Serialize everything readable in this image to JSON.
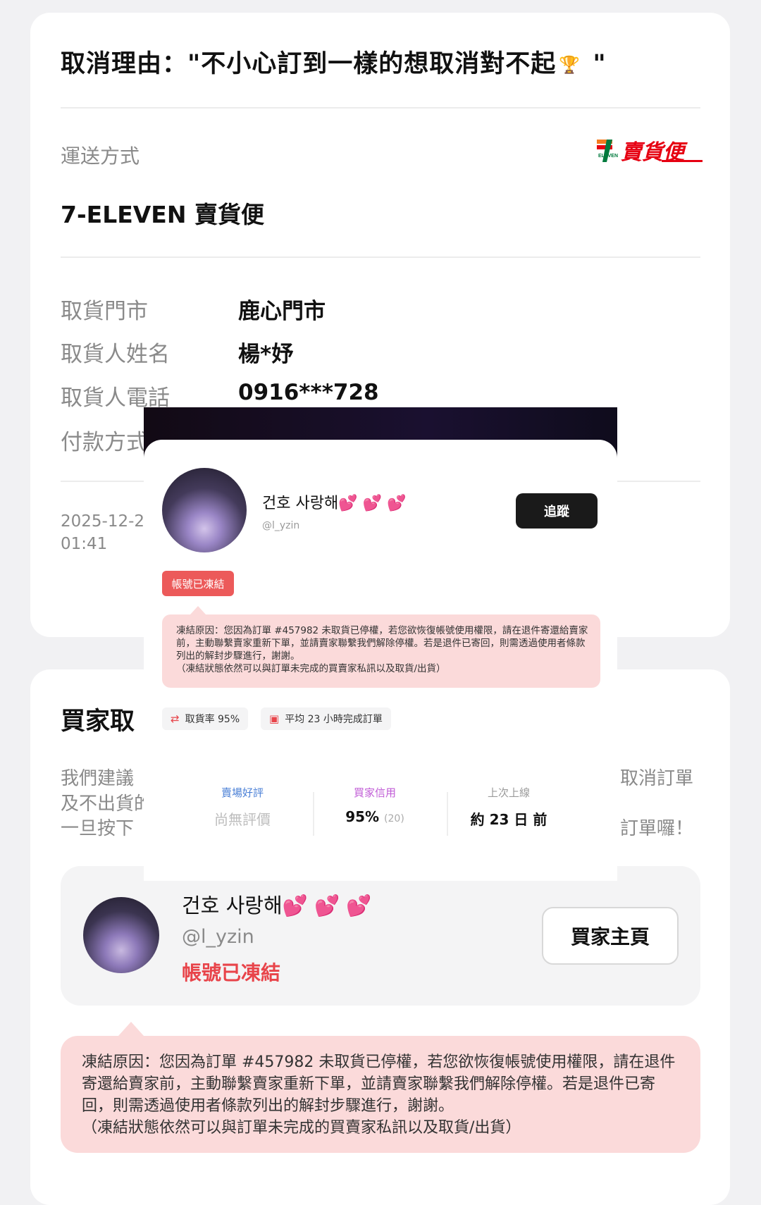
{
  "order": {
    "cancel_reason": "取消理由：\"不小心訂到一樣的想取消對不起",
    "cancel_reason_suffix": " \"",
    "shipping_label": "運送方式",
    "shipping_logo_small": "ELEVEN",
    "shipping_logo_text": "賣貨便",
    "shipping_method": "7-ELEVEN 賣貨便",
    "rows": [
      {
        "label": "取貨門市",
        "value": "鹿心門市"
      },
      {
        "label": "取貨人姓名",
        "value": "楊*妤"
      },
      {
        "label": "取貨人電話",
        "value": "0916***728"
      },
      {
        "label": "付款方式",
        "value": ""
      }
    ],
    "date_partial": "2025-12-2",
    "time_partial": "01:41"
  },
  "buyer_section": {
    "title_partial": "買家取",
    "advice_lines": [
      "我們建議",
      "及不出貨的",
      "一旦按下"
    ],
    "advice_right": [
      "取消訂單",
      "訂單囉！"
    ]
  },
  "buyer": {
    "name": "건호 사랑해💕 💕 💕",
    "handle": "@l_yzin",
    "frozen_label": "帳號已凍結",
    "home_button": "買家主頁",
    "freeze_reason": "凍結原因：您因為訂單 #457982 未取貨已停權，若您欲恢復帳號使用權限，請在退件寄還給賣家前，主動聯繫賣家重新下單，並請賣家聯繫我們解除停權。若是退件已寄回，則需透過使用者條款列出的解封步驟進行，謝謝。",
    "freeze_note": "（凍結狀態依然可以與訂單未完成的買賣家私訊以及取貨/出貨）"
  },
  "overlay": {
    "name": "건호 사랑해💕 💕 💕",
    "handle": "@l_yzin",
    "follow_button": "追蹤",
    "frozen_badge": "帳號已凍結",
    "freeze_reason": "凍結原因：您因為訂單 #457982 未取貨已停權，若您欲恢復帳號使用權限，請在退件寄還給賣家前，主動聯繫賣家重新下單，並請賣家聯繫我們解除停權。若是退件已寄回，則需透過使用者條款列出的解封步驟進行，謝謝。",
    "freeze_note": "（凍結狀態依然可以與訂單未完成的買賣家私訊以及取貨/出貨）",
    "chips": [
      "取貨率 95%",
      "平均 23 小時完成訂單"
    ],
    "stats": [
      {
        "label": "賣場好評",
        "value": "尚無評價",
        "label_color": "#4a7fd6"
      },
      {
        "label": "買家信用",
        "value": "95%",
        "sub": "(20)",
        "label_color": "#c05bd6"
      },
      {
        "label": "上次上線",
        "value": "約 23 日 前",
        "label_color": "#9a9a9a"
      }
    ]
  },
  "colors": {
    "accent_red": "#e8444a",
    "freeze_bg": "#fbdada",
    "page_bg": "#f1f1f3"
  }
}
